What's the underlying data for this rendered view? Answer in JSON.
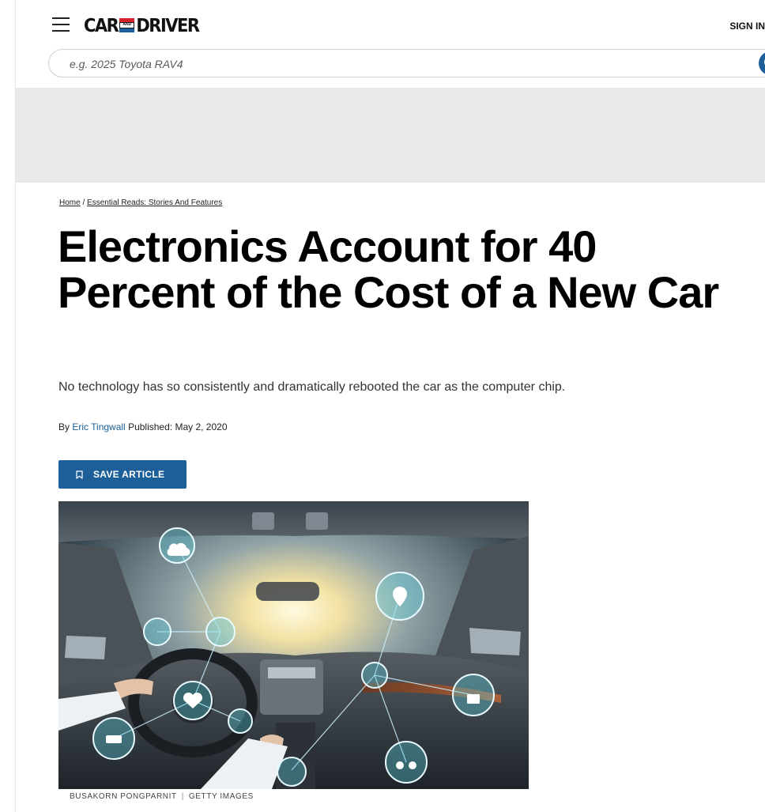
{
  "header": {
    "logo": {
      "left": "CAR",
      "middle": "AND",
      "right": "DRIVER"
    },
    "sign_in": "SIGN IN",
    "search": {
      "placeholder": "e.g. 2025 Toyota RAV4"
    }
  },
  "breadcrumb": [
    {
      "label": "Home"
    },
    {
      "label": "Essential Reads: Stories And Features"
    }
  ],
  "article": {
    "title": "Electronics Account for 40 Percent of the Cost of a New Car",
    "dek": "No technology has so consistently and dramatically rebooted the car as the computer chip.",
    "byline": {
      "prefix": "By",
      "author": "Eric Tingwall",
      "published_label": "Published:",
      "date": "May 2, 2020"
    },
    "save_label": "SAVE ARTICLE",
    "image_credit": {
      "photographer": "BUSAKORN PONGPARNIT",
      "agency": "GETTY IMAGES"
    }
  },
  "icons": [
    "menu-icon",
    "search-icon",
    "bookmark-icon"
  ],
  "colors": {
    "accent": "#1d5f98",
    "logo_red": "#d6232b",
    "logo_blue": "#1b5e9b",
    "ad_band": "#e9e9e9"
  }
}
